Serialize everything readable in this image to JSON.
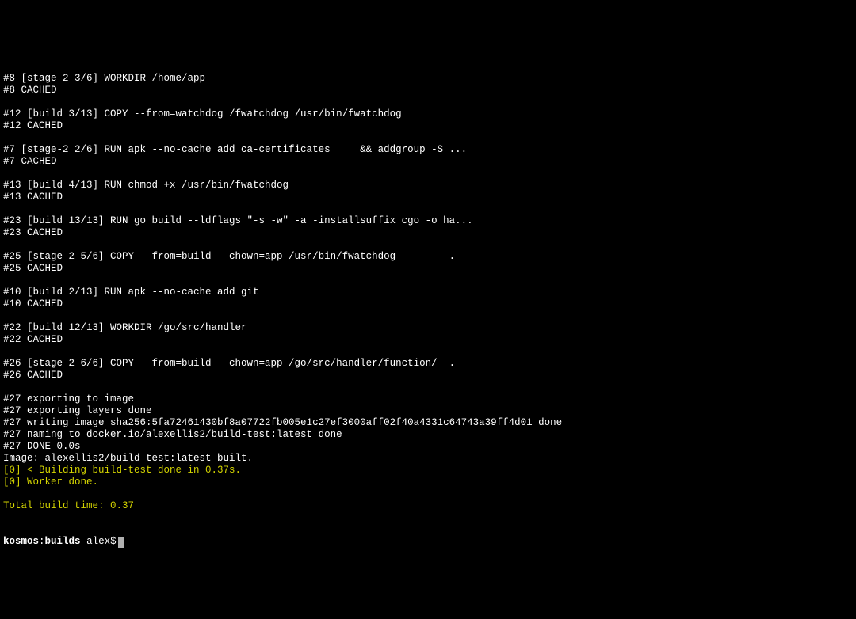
{
  "terminal": {
    "lines": [
      {
        "text": "#8 [stage-2 3/6] WORKDIR /home/app",
        "class": ""
      },
      {
        "text": "#8 CACHED",
        "class": ""
      },
      {
        "text": "",
        "class": ""
      },
      {
        "text": "#12 [build 3/13] COPY --from=watchdog /fwatchdog /usr/bin/fwatchdog",
        "class": ""
      },
      {
        "text": "#12 CACHED",
        "class": ""
      },
      {
        "text": "",
        "class": ""
      },
      {
        "text": "#7 [stage-2 2/6] RUN apk --no-cache add ca-certificates     && addgroup -S ...",
        "class": ""
      },
      {
        "text": "#7 CACHED",
        "class": ""
      },
      {
        "text": "",
        "class": ""
      },
      {
        "text": "#13 [build 4/13] RUN chmod +x /usr/bin/fwatchdog",
        "class": ""
      },
      {
        "text": "#13 CACHED",
        "class": ""
      },
      {
        "text": "",
        "class": ""
      },
      {
        "text": "#23 [build 13/13] RUN go build --ldflags \"-s -w\" -a -installsuffix cgo -o ha...",
        "class": ""
      },
      {
        "text": "#23 CACHED",
        "class": ""
      },
      {
        "text": "",
        "class": ""
      },
      {
        "text": "#25 [stage-2 5/6] COPY --from=build --chown=app /usr/bin/fwatchdog         .",
        "class": ""
      },
      {
        "text": "#25 CACHED",
        "class": ""
      },
      {
        "text": "",
        "class": ""
      },
      {
        "text": "#10 [build 2/13] RUN apk --no-cache add git",
        "class": ""
      },
      {
        "text": "#10 CACHED",
        "class": ""
      },
      {
        "text": "",
        "class": ""
      },
      {
        "text": "#22 [build 12/13] WORKDIR /go/src/handler",
        "class": ""
      },
      {
        "text": "#22 CACHED",
        "class": ""
      },
      {
        "text": "",
        "class": ""
      },
      {
        "text": "#26 [stage-2 6/6] COPY --from=build --chown=app /go/src/handler/function/  .",
        "class": ""
      },
      {
        "text": "#26 CACHED",
        "class": ""
      },
      {
        "text": "",
        "class": ""
      },
      {
        "text": "#27 exporting to image",
        "class": ""
      },
      {
        "text": "#27 exporting layers done",
        "class": ""
      },
      {
        "text": "#27 writing image sha256:5fa72461430bf8a07722fb005e1c27ef3000aff02f40a4331c64743a39ff4d01 done",
        "class": ""
      },
      {
        "text": "#27 naming to docker.io/alexellis2/build-test:latest done",
        "class": ""
      },
      {
        "text": "#27 DONE 0.0s",
        "class": ""
      },
      {
        "text": "Image: alexellis2/build-test:latest built.",
        "class": ""
      },
      {
        "text": "[0] < Building build-test done in 0.37s.",
        "class": "yellow"
      },
      {
        "text": "[0] Worker done.",
        "class": "yellow"
      },
      {
        "text": "",
        "class": ""
      },
      {
        "text": "Total build time: 0.37",
        "class": "yellow"
      }
    ],
    "prompt": {
      "host": "kosmos",
      "dir": "builds",
      "user": "alex",
      "symbol": "$"
    }
  }
}
